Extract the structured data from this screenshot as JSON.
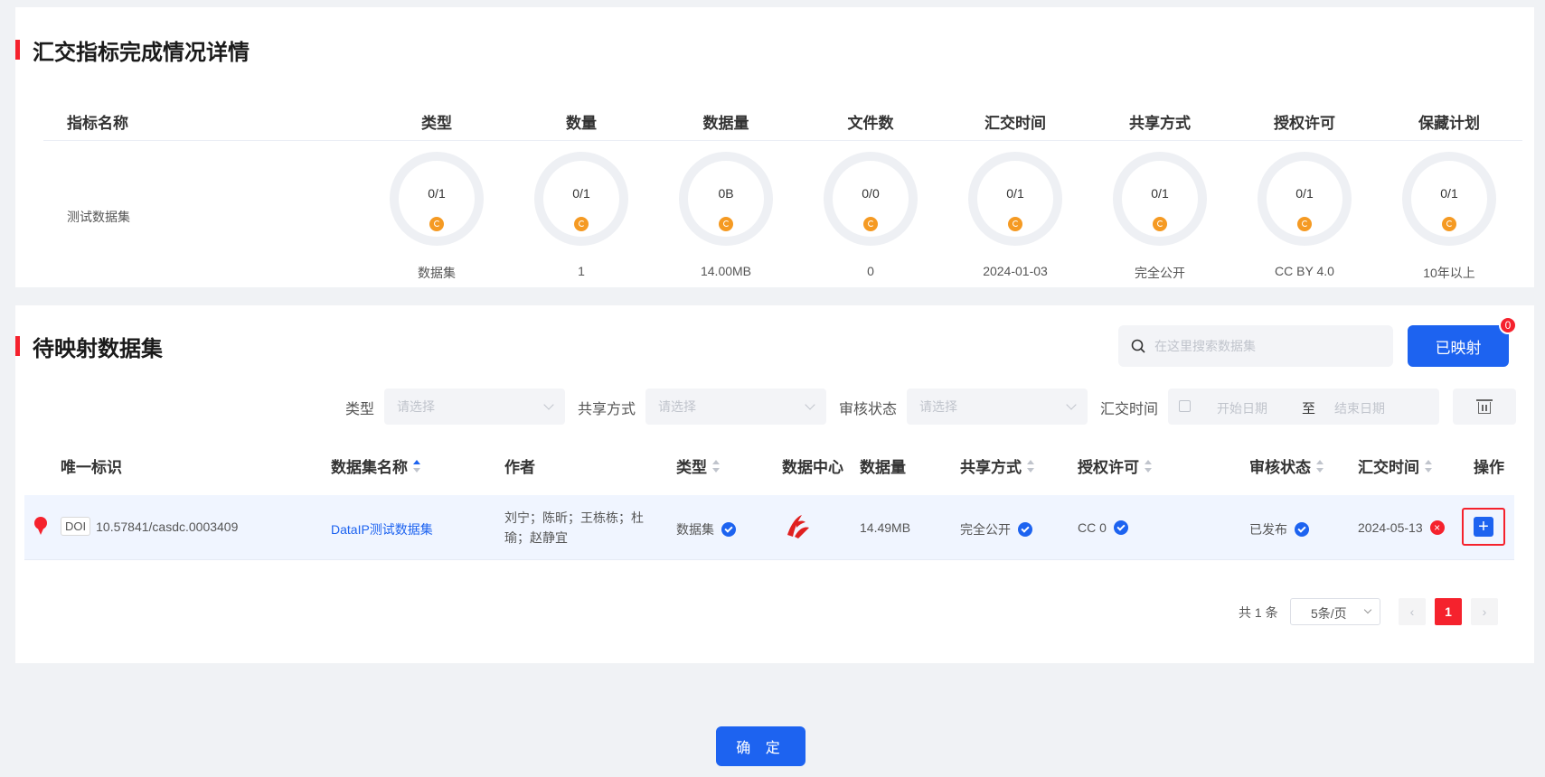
{
  "summary": {
    "title": "汇交指标完成情况详情",
    "columns": [
      "指标名称",
      "类型",
      "数量",
      "数据量",
      "文件数",
      "汇交时间",
      "共享方式",
      "授权许可",
      "保藏计划"
    ],
    "row_name": "测试数据集",
    "metrics": [
      {
        "value": "0/1",
        "sub": "数据集"
      },
      {
        "value": "0/1",
        "sub": "1"
      },
      {
        "value": "0B",
        "sub": "14.00MB"
      },
      {
        "value": "0/0",
        "sub": "0"
      },
      {
        "value": "0/1",
        "sub": "2024-01-03"
      },
      {
        "value": "0/1",
        "sub": "完全公开"
      },
      {
        "value": "0/1",
        "sub": "CC BY 4.0"
      },
      {
        "value": "0/1",
        "sub": "10年以上"
      }
    ]
  },
  "pending": {
    "title": "待映射数据集",
    "search_placeholder": "在这里搜索数据集",
    "mapped_label": "已映射",
    "mapped_count": "0",
    "filters": {
      "type_label": "类型",
      "share_label": "共享方式",
      "review_label": "审核状态",
      "time_label": "汇交时间",
      "select_placeholder": "请选择",
      "start_placeholder": "开始日期",
      "range_sep": "至",
      "end_placeholder": "结束日期"
    },
    "columns": [
      "唯一标识",
      "数据集名称",
      "作者",
      "类型",
      "数据中心",
      "数据量",
      "共享方式",
      "授权许可",
      "审核状态",
      "汇交时间",
      "操作"
    ],
    "row": {
      "doi_tag": "DOI",
      "doi": "10.57841/casdc.0003409",
      "name": "DataIP测试数据集",
      "authors": "刘宁；陈昕；王栋栋；杜瑜；赵静宜",
      "type": "数据集",
      "size": "14.49MB",
      "share": "完全公开",
      "license": "CC 0",
      "review": "已发布",
      "time": "2024-05-13"
    },
    "pager": {
      "total": "共 1 条",
      "page_size": "5条/页",
      "current": "1"
    }
  },
  "confirm_label": "确 定",
  "colors": {
    "primary": "#1d63f0",
    "accent_red": "#f5222d",
    "donut_dot": "#f59a23"
  }
}
